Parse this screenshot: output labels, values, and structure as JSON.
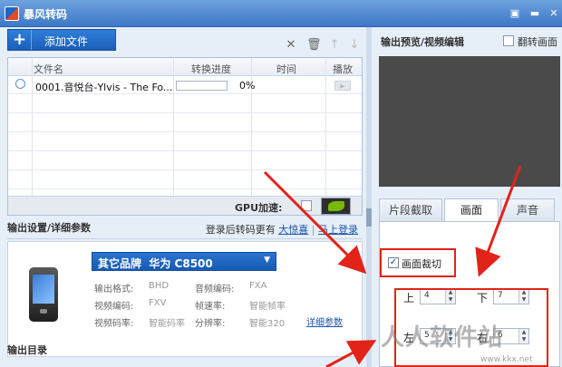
{
  "window": {
    "title": "暴风转码",
    "minimize_icon": "minimize-icon",
    "restore_icon": "restore-icon",
    "close_icon": "close-icon"
  },
  "toolbar": {
    "add_label": "添加文件",
    "plus_icon": "plus-icon",
    "delete_icon": "close-icon",
    "trash_icon": "trash-icon",
    "up_icon": "arrow-up-icon",
    "down_icon": "arrow-down-icon"
  },
  "file_list": {
    "columns": [
      "文件名",
      "转换进度",
      "时间",
      "播放"
    ],
    "rows": [
      {
        "name": "0001.音悦台-Ylvis - The Fo...",
        "progress_text": "0%",
        "progress": 0
      }
    ],
    "gpu_label": "GPU加速:"
  },
  "output_settings": {
    "title": "输出设置/详细参数",
    "login_hint": "登录后转码更有",
    "login_link1": "大惊喜",
    "login_link2": "马上登录",
    "brand": "其它品牌",
    "model": "华为  C8500",
    "specs": {
      "format_k": "输出格式:",
      "format_v": "BHD",
      "audio_codec_k": "音频编码:",
      "audio_codec_v": "FXA",
      "video_codec_k": "视频编码:",
      "video_codec_v": "FXV",
      "fps_k": "帧速率:",
      "fps_v": "智能帧率",
      "bitrate_k": "视频码率:",
      "bitrate_v": "智能码率",
      "resolution_k": "分辨率:",
      "resolution_v": "智能320"
    },
    "detail_link": "详细参数"
  },
  "output_dir": {
    "title": "输出目录"
  },
  "preview": {
    "title": "输出预览/视频编辑",
    "flip_label": "翻转画面",
    "tabs": [
      "片段截取",
      "画面",
      "声音"
    ],
    "active_tab": 1
  },
  "crop": {
    "label": "画面裁切",
    "checked": true,
    "top_label": "上",
    "top_value": "4",
    "bottom_label": "下",
    "bottom_value": "7",
    "left_label": "左",
    "left_value": "5",
    "right_label": "右",
    "right_value": "6"
  },
  "watermark": {
    "text": "人人软件站",
    "url": "www.kkx.net"
  },
  "colors": {
    "annotation_red": "#e2231a",
    "title_blue": "#3d78c7"
  }
}
